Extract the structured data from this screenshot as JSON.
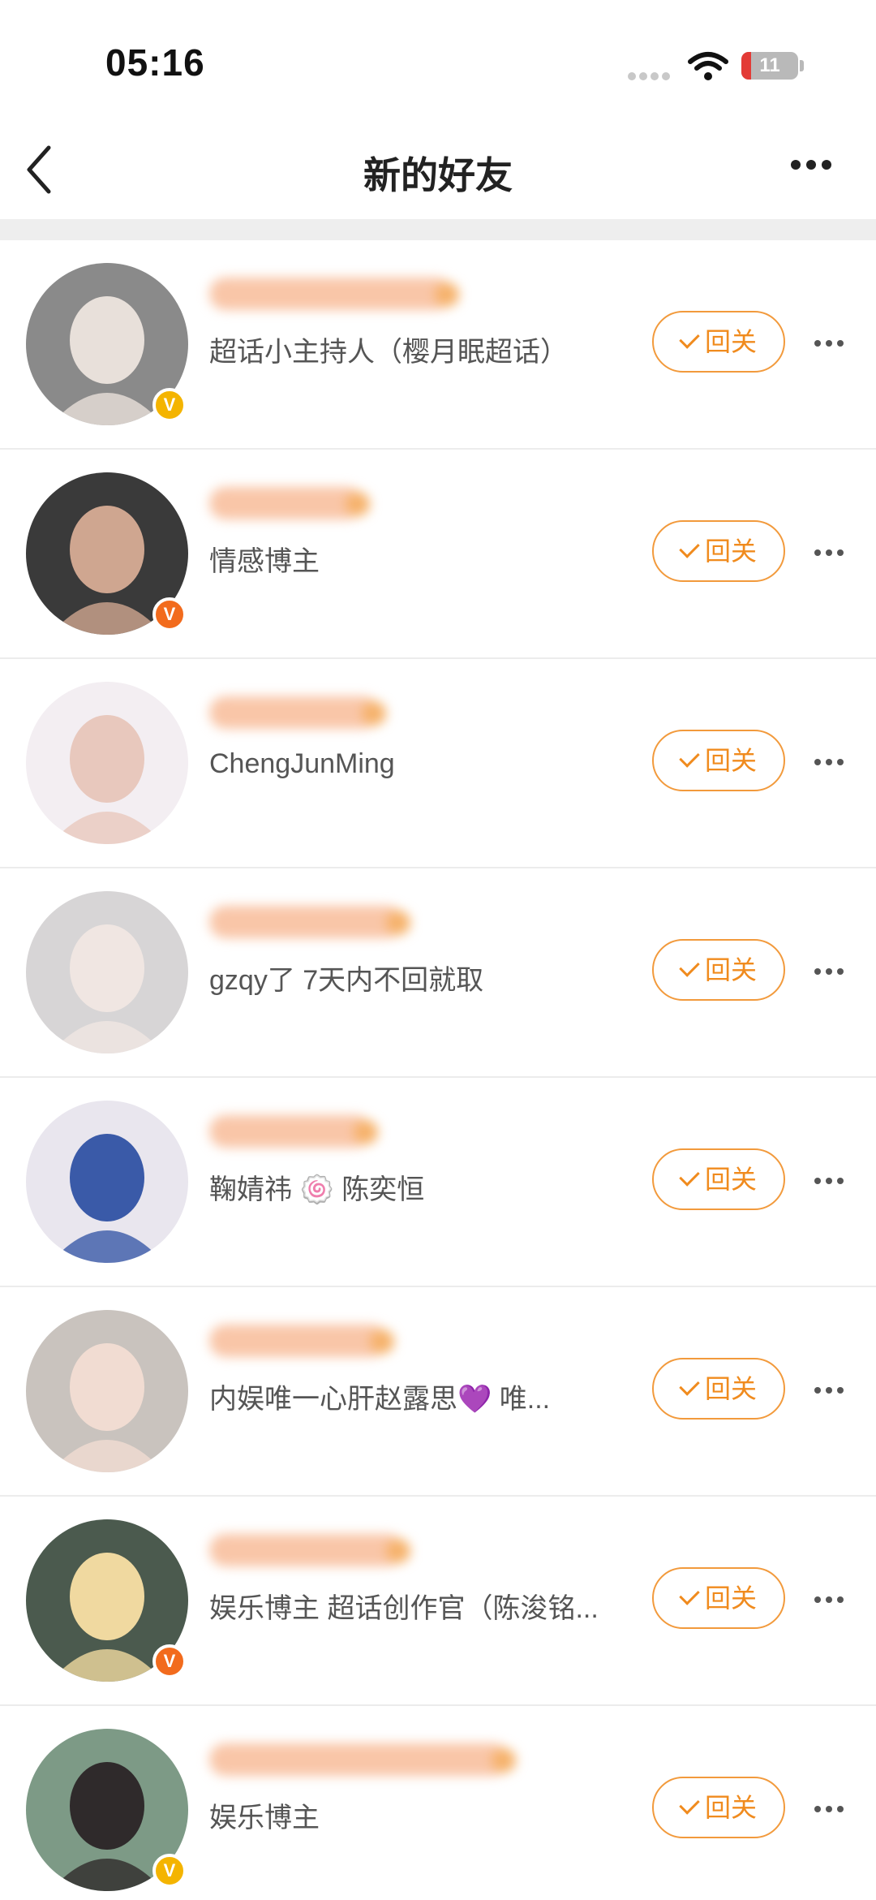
{
  "status_bar": {
    "time": "05:16",
    "battery": "11"
  },
  "nav": {
    "title": "新的好友"
  },
  "follow_back_label": "回关",
  "friends": [
    {
      "description": "超话小主持人（樱月眠超话）",
      "badge": "V",
      "badge_color": "#f4b400",
      "avatar_bg": "#8a8a8a",
      "avatar_fg": "#e8e0da"
    },
    {
      "description": "情感博主",
      "badge": "V",
      "badge_color": "#f26b1d",
      "avatar_bg": "#3a3a3a",
      "avatar_fg": "#cfa690"
    },
    {
      "description": "ChengJunMing",
      "badge": "",
      "badge_color": "",
      "avatar_bg": "#f3eef2",
      "avatar_fg": "#e8c8bd"
    },
    {
      "description": "gzqy了 7天内不回就取",
      "badge": "",
      "badge_color": "",
      "avatar_bg": "#d7d5d6",
      "avatar_fg": "#f0e6e2"
    },
    {
      "description": "鞠婧祎 🍥 陈奕恒",
      "badge": "",
      "badge_color": "",
      "avatar_bg": "#e9e6ee",
      "avatar_fg": "#3a5aa8"
    },
    {
      "description": "内娱唯一心肝赵露思💜 唯...",
      "badge": "",
      "badge_color": "",
      "avatar_bg": "#c9c3be",
      "avatar_fg": "#f1dcd2"
    },
    {
      "description": "娱乐博主 超话创作官（陈浚铭...",
      "badge": "V",
      "badge_color": "#f26b1d",
      "avatar_bg": "#4b5a4e",
      "avatar_fg": "#f0d9a0"
    },
    {
      "description": "娱乐博主",
      "badge": "V",
      "badge_color": "#f4b400",
      "avatar_bg": "#7d9a86",
      "avatar_fg": "#2f2a2b"
    }
  ]
}
